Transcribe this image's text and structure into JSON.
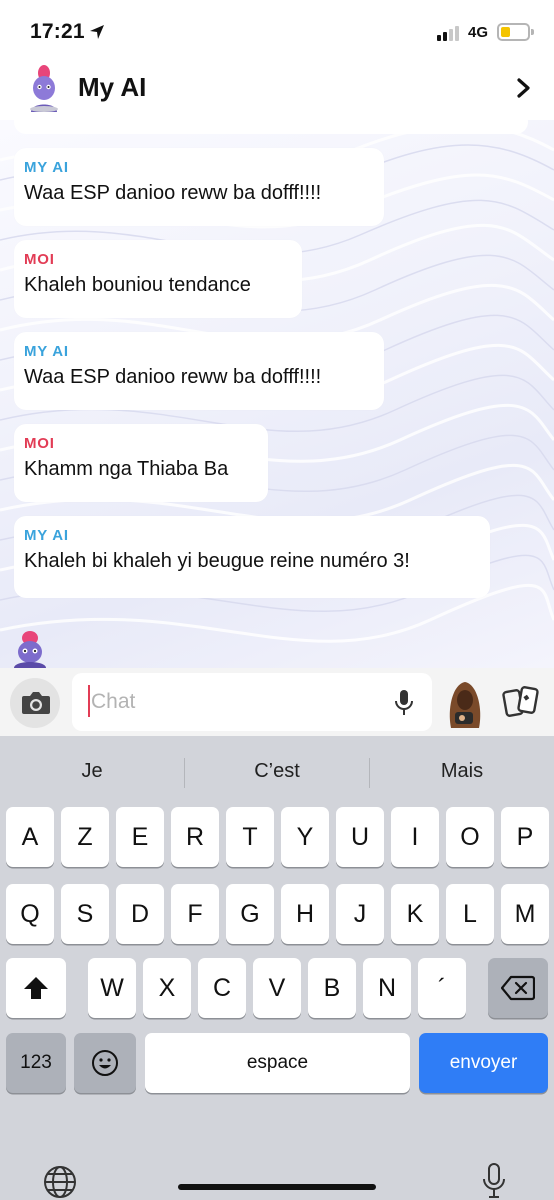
{
  "status_bar": {
    "time": "17:21",
    "network": "4G"
  },
  "header": {
    "title": "My AI"
  },
  "messages": [
    {
      "sender": "MY AI",
      "text": "Waa ESP danioo reww ba dofff!!!!"
    },
    {
      "sender": "MOI",
      "text": "Khaleh bouniou tendance"
    },
    {
      "sender": "MY AI",
      "text": "Waa ESP danioo reww ba dofff!!!!"
    },
    {
      "sender": "MOI",
      "text": "Khamm nga Thiaba Ba"
    },
    {
      "sender": "MY AI",
      "text": "Khaleh bi khaleh yi beugue reine numéro 3!"
    }
  ],
  "input": {
    "placeholder": "Chat"
  },
  "keyboard": {
    "suggestions": [
      "Je",
      "C’est",
      "Mais"
    ],
    "row1": [
      "A",
      "Z",
      "E",
      "R",
      "T",
      "Y",
      "U",
      "I",
      "O",
      "P"
    ],
    "row2": [
      "Q",
      "S",
      "D",
      "F",
      "G",
      "H",
      "J",
      "K",
      "L",
      "M"
    ],
    "row3": [
      "W",
      "X",
      "C",
      "V",
      "B",
      "N",
      "´"
    ],
    "numbers_key": "123",
    "space_key": "espace",
    "send_key": "envoyer"
  },
  "colors": {
    "ai_label": "#3aa3dc",
    "me_label": "#e23c55",
    "send_key": "#2f7df6"
  }
}
